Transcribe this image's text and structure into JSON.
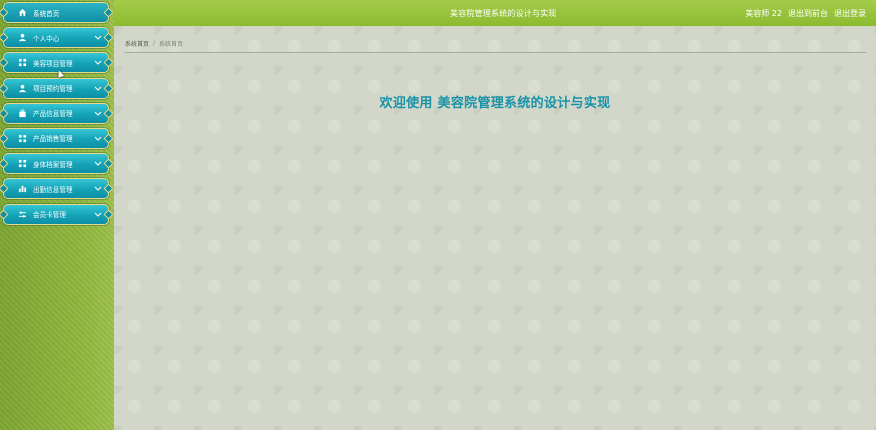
{
  "header": {
    "title": "美容院管理系统的设计与实现",
    "user_info": "美容师 22",
    "back_link": "退出到前台",
    "logout_link": "退出登录"
  },
  "sidebar": {
    "items": [
      {
        "label": "系统首页",
        "icon": "home-icon"
      },
      {
        "label": "个人中心",
        "icon": "user-icon"
      },
      {
        "label": "美容项目管理",
        "icon": "grid-icon"
      },
      {
        "label": "项目预约管理",
        "icon": "user-icon"
      },
      {
        "label": "产品信息管理",
        "icon": "box-icon"
      },
      {
        "label": "产品销售管理",
        "icon": "grid-icon"
      },
      {
        "label": "身体档案管理",
        "icon": "grid-icon"
      },
      {
        "label": "出勤信息管理",
        "icon": "chart-icon"
      },
      {
        "label": "会员卡管理",
        "icon": "sliders-icon"
      }
    ]
  },
  "breadcrumb": {
    "home": "系统首页",
    "separator": "/",
    "current": "系统首页"
  },
  "main": {
    "welcome": "欢迎使用 美容院管理系统的设计与实现"
  },
  "colors": {
    "header_green": "#8bbb2f",
    "menu_teal": "#15a2b6",
    "menu_border": "#e6d98a",
    "welcome_text": "#1792a8"
  }
}
